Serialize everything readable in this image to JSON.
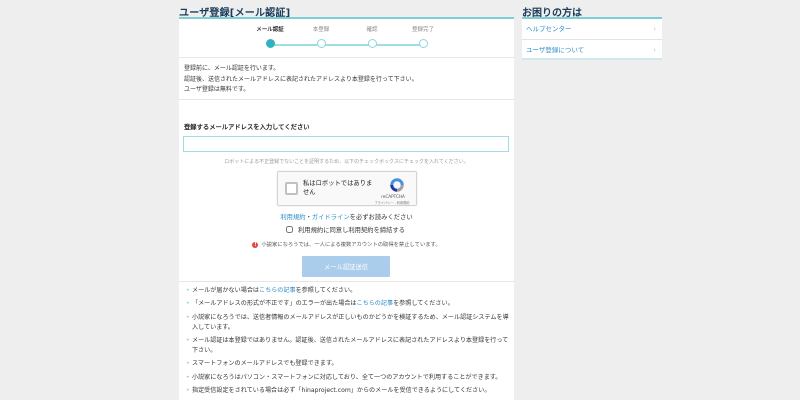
{
  "page": {
    "title": "ユーザ登録[メール認証]",
    "steps": [
      {
        "label": "メール認証",
        "active": true
      },
      {
        "label": "本登録",
        "active": false
      },
      {
        "label": "確認",
        "active": false
      },
      {
        "label": "登録完了",
        "active": false
      }
    ],
    "intro": [
      "登録前に、メール認証を行います。",
      "認証後、送信されたメールアドレスに表記されたアドレスより本登録を行って下さい。",
      "ユーザ登録は無料です。"
    ],
    "form": {
      "email_label": "登録するメールアドレスを入力してください",
      "email_value": "",
      "captcha_note": "ロボットによる不正登録でないことを証明するため、以下のチェックボックスにチェックを入れてください。",
      "captcha": {
        "label": "私はロボットではありません",
        "brand": "reCAPTCHA",
        "terms": "プライバシー - 利用規約"
      },
      "terms_link": "利用規約",
      "terms_sep": "・",
      "guide_link": "ガイドライン",
      "terms_suffix": "を必ずお読みください",
      "agree_label": "利用規約に同意し利用契約を締結する",
      "warning": "小説家になろうでは、一人による複数アカウントの取得を禁止しています。",
      "submit_label": "メール認証送信"
    },
    "notes": [
      {
        "pre": "メールが届かない場合は",
        "link": "こちらの記事",
        "post": "を参照してください。"
      },
      {
        "pre": "「メールアドレスの形式が不正です」のエラーが出た場合は",
        "link": "こちらの記事",
        "post": "を参照してください。"
      },
      {
        "pre": "小説家になろうでは、送信者情報のメールアドレスが正しいものかどうかを検証するため、メール認証システムを導入しています。",
        "link": "",
        "post": ""
      },
      {
        "pre": "メール認証は本登録ではありません。認証後、送信されたメールアドレスに表記されたアドレスより本登録を行って下さい。",
        "link": "",
        "post": ""
      },
      {
        "pre": "スマートフォンのメールアドレスでも登録できます。",
        "link": "",
        "post": ""
      },
      {
        "pre": "小説家になろうはパソコン・スマートフォンに対応しており、全て一つのアカウントで利用することができます。",
        "link": "",
        "post": ""
      },
      {
        "pre": "指定受信設定をされている場合は必ず「hinaproject.com」からのメールを受信できるようにしてください。",
        "link": "",
        "post": ""
      }
    ]
  },
  "sidebar": {
    "title": "お困りの方は",
    "links": [
      {
        "label": "ヘルプセンター"
      },
      {
        "label": "ユーザ登録について"
      }
    ]
  },
  "colors": {
    "accent": "#2fb3c0",
    "link": "#2d8fc9",
    "button_disabled": "#a9cdeb",
    "warning": "#e0463e"
  }
}
